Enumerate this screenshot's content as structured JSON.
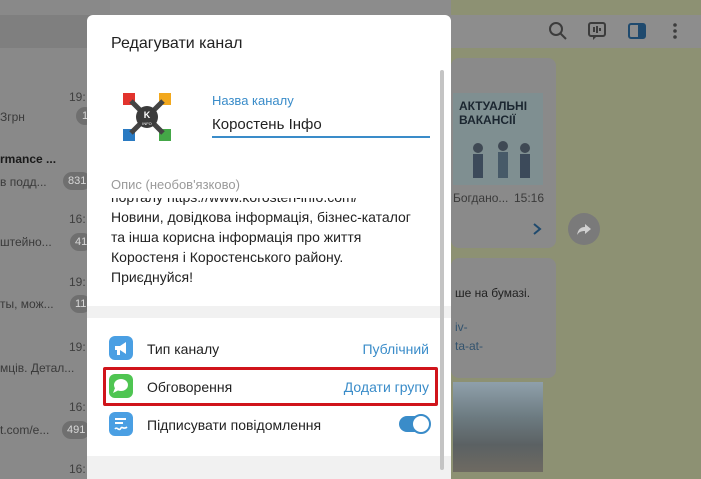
{
  "chat_list": {
    "rows": [
      {
        "time": "19:",
        "text": "Згрн",
        "badge": "1",
        "bold": false
      },
      {
        "time": "",
        "text": "rmance ...",
        "badge": "",
        "bold": true
      },
      {
        "time": "",
        "text": "в подд...",
        "badge": "831",
        "bold": false
      },
      {
        "time": "16:",
        "text": "штейно...",
        "badge": "41",
        "bold": false
      },
      {
        "time": "19:",
        "text": "ты, мож...",
        "badge": "11",
        "bold": false
      },
      {
        "time": "19:",
        "text": "мців. Детал...",
        "badge": "",
        "bold": false
      },
      {
        "time": "16:",
        "text": "t.com/e...",
        "badge": "491",
        "bold": false
      },
      {
        "time": "16:",
        "text": "",
        "badge": "",
        "bold": false
      }
    ]
  },
  "chat_pane": {
    "poster_title": "АКТУАЛЬНІ ВАКАНСІЇ",
    "sender": "Богдано...",
    "time": "15:16",
    "message_text": "ше на бумазі.",
    "link_line1": "iv-",
    "link_line2": "ta-at-"
  },
  "modal": {
    "title": "Редагувати канал",
    "channel_name_label": "Назва каналу",
    "channel_name_value": "Коростень Інфо",
    "description_label": "Опис (необов'язково)",
    "description_lines": [
      "порталу https://www.korosten-info.com/",
      "Новини, довідкова інформація, бізнес-каталог",
      "та інша корисна інформація про життя",
      "Коростеня і Коростенського району.",
      "Приєднуйся!"
    ],
    "settings": [
      {
        "label": "Тип каналу",
        "value": "Публічний",
        "icon": "megaphone-icon"
      },
      {
        "label": "Обговорення",
        "value": "Додати групу",
        "icon": "chat-bubble-icon"
      },
      {
        "label": "Підписувати повідомлення",
        "value": "",
        "icon": "signature-icon",
        "toggle_on": true
      }
    ],
    "logo_text": "K INFO"
  },
  "colors": {
    "accent": "#3a8cc9",
    "highlight": "#d0141b",
    "megaphone_icon_bg": "#4a9fe3",
    "discussion_icon_bg": "#4fc552",
    "signature_icon_bg": "#4a9fe3"
  }
}
